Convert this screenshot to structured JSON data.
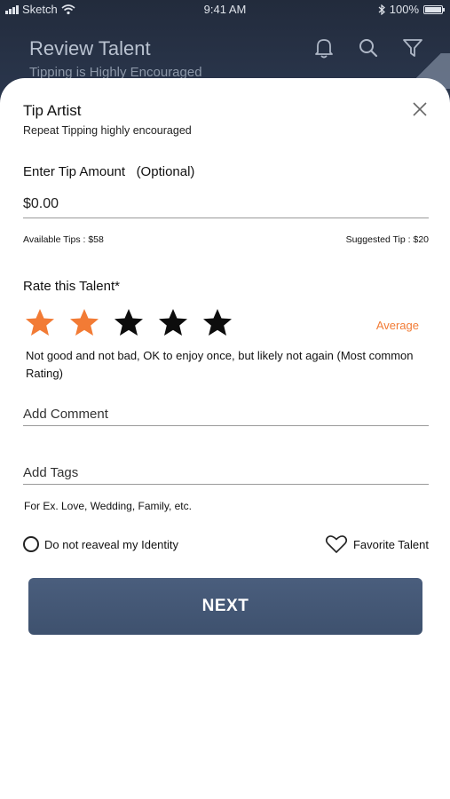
{
  "status_bar": {
    "carrier": "Sketch",
    "time": "9:41 AM",
    "battery": "100%"
  },
  "app_header": {
    "title": "Review Talent",
    "subtitle": "Tipping is Highly Encouraged",
    "icons": [
      "bell-icon",
      "search-icon",
      "filter-icon"
    ]
  },
  "dialog": {
    "title": "Tip Artist",
    "subtitle": "Repeat Tipping highly encouraged",
    "tip_label": "Enter Tip Amount   (Optional)",
    "tip_value": "$0.00",
    "available_tips": "Available Tips : $58",
    "suggested_tip": "Suggested Tip : $20",
    "rate_label": "Rate this Talent*",
    "rating": {
      "value": 2,
      "max": 5,
      "word": "Average"
    },
    "rating_description": "Not good and not bad, OK to enjoy once, but likely not again (Most common Rating)",
    "comment_placeholder": "Add Comment",
    "tags_placeholder": "Add Tags",
    "tags_hint": "For Ex. Love, Wedding, Family, etc.",
    "anonymous_label": "Do not reaveal my Identity",
    "favorite_label": "Favorite Talent",
    "next_label": "NEXT"
  },
  "colors": {
    "accent": "#f27b35",
    "button": "#435675",
    "header_bg": "#2a3446"
  }
}
